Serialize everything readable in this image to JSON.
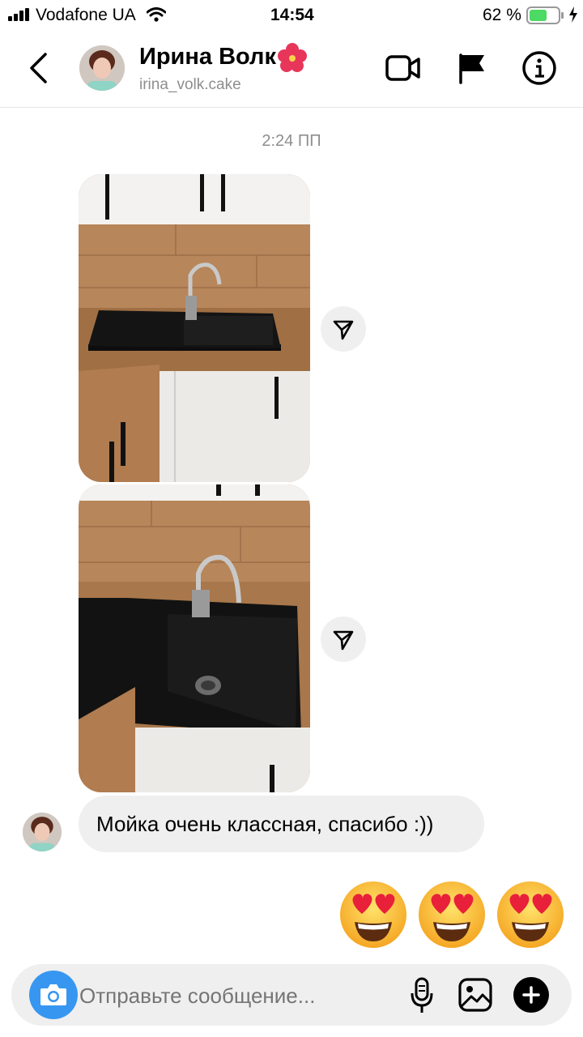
{
  "status_bar": {
    "carrier": "Vodafone UA",
    "time": "14:54",
    "battery": "62 %",
    "battery_level": 0.62
  },
  "header": {
    "name": "Ирина Волк",
    "username": "irina_volk.cake",
    "icons": [
      "back-icon",
      "hibiscus-emoji-icon",
      "video-call-icon",
      "flag-icon",
      "info-icon"
    ]
  },
  "chat": {
    "timestamp": "2:24 ПП",
    "message_text": "Мойка очень классная, спасибо :))",
    "reactions": [
      "😍",
      "😍",
      "😍"
    ]
  },
  "composer": {
    "placeholder": "Отправьте сообщение...",
    "icons": [
      "camera-icon",
      "microphone-icon",
      "gallery-icon",
      "plus-icon"
    ]
  },
  "colors": {
    "accent": "#3797f0",
    "bubble": "#efefef",
    "muted": "#8e8e8e"
  }
}
